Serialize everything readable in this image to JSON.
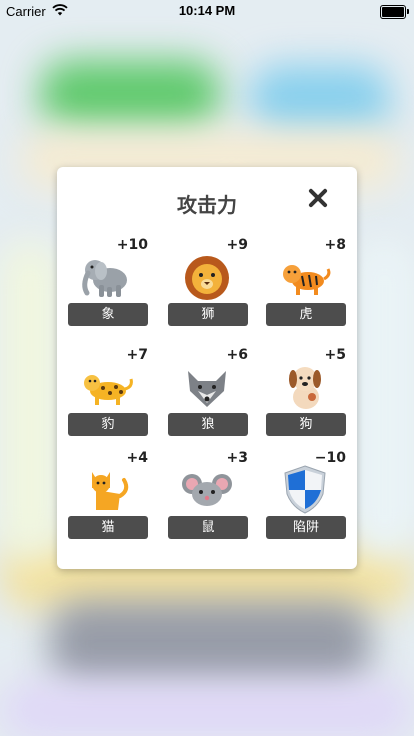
{
  "status_bar": {
    "carrier": "Carrier",
    "time": "10:14 PM"
  },
  "modal": {
    "title": "攻击力",
    "items": [
      {
        "name": "象",
        "power": "+10",
        "icon": "elephant-icon"
      },
      {
        "name": "狮",
        "power": "+9",
        "icon": "lion-icon"
      },
      {
        "name": "虎",
        "power": "+8",
        "icon": "tiger-icon"
      },
      {
        "name": "豹",
        "power": "+7",
        "icon": "leopard-icon"
      },
      {
        "name": "狼",
        "power": "+6",
        "icon": "wolf-icon"
      },
      {
        "name": "狗",
        "power": "+5",
        "icon": "dog-icon"
      },
      {
        "name": "猫",
        "power": "+4",
        "icon": "cat-icon"
      },
      {
        "name": "鼠",
        "power": "+3",
        "icon": "mouse-icon"
      },
      {
        "name": "陷阱",
        "power": "−10",
        "icon": "shield-icon"
      }
    ]
  }
}
